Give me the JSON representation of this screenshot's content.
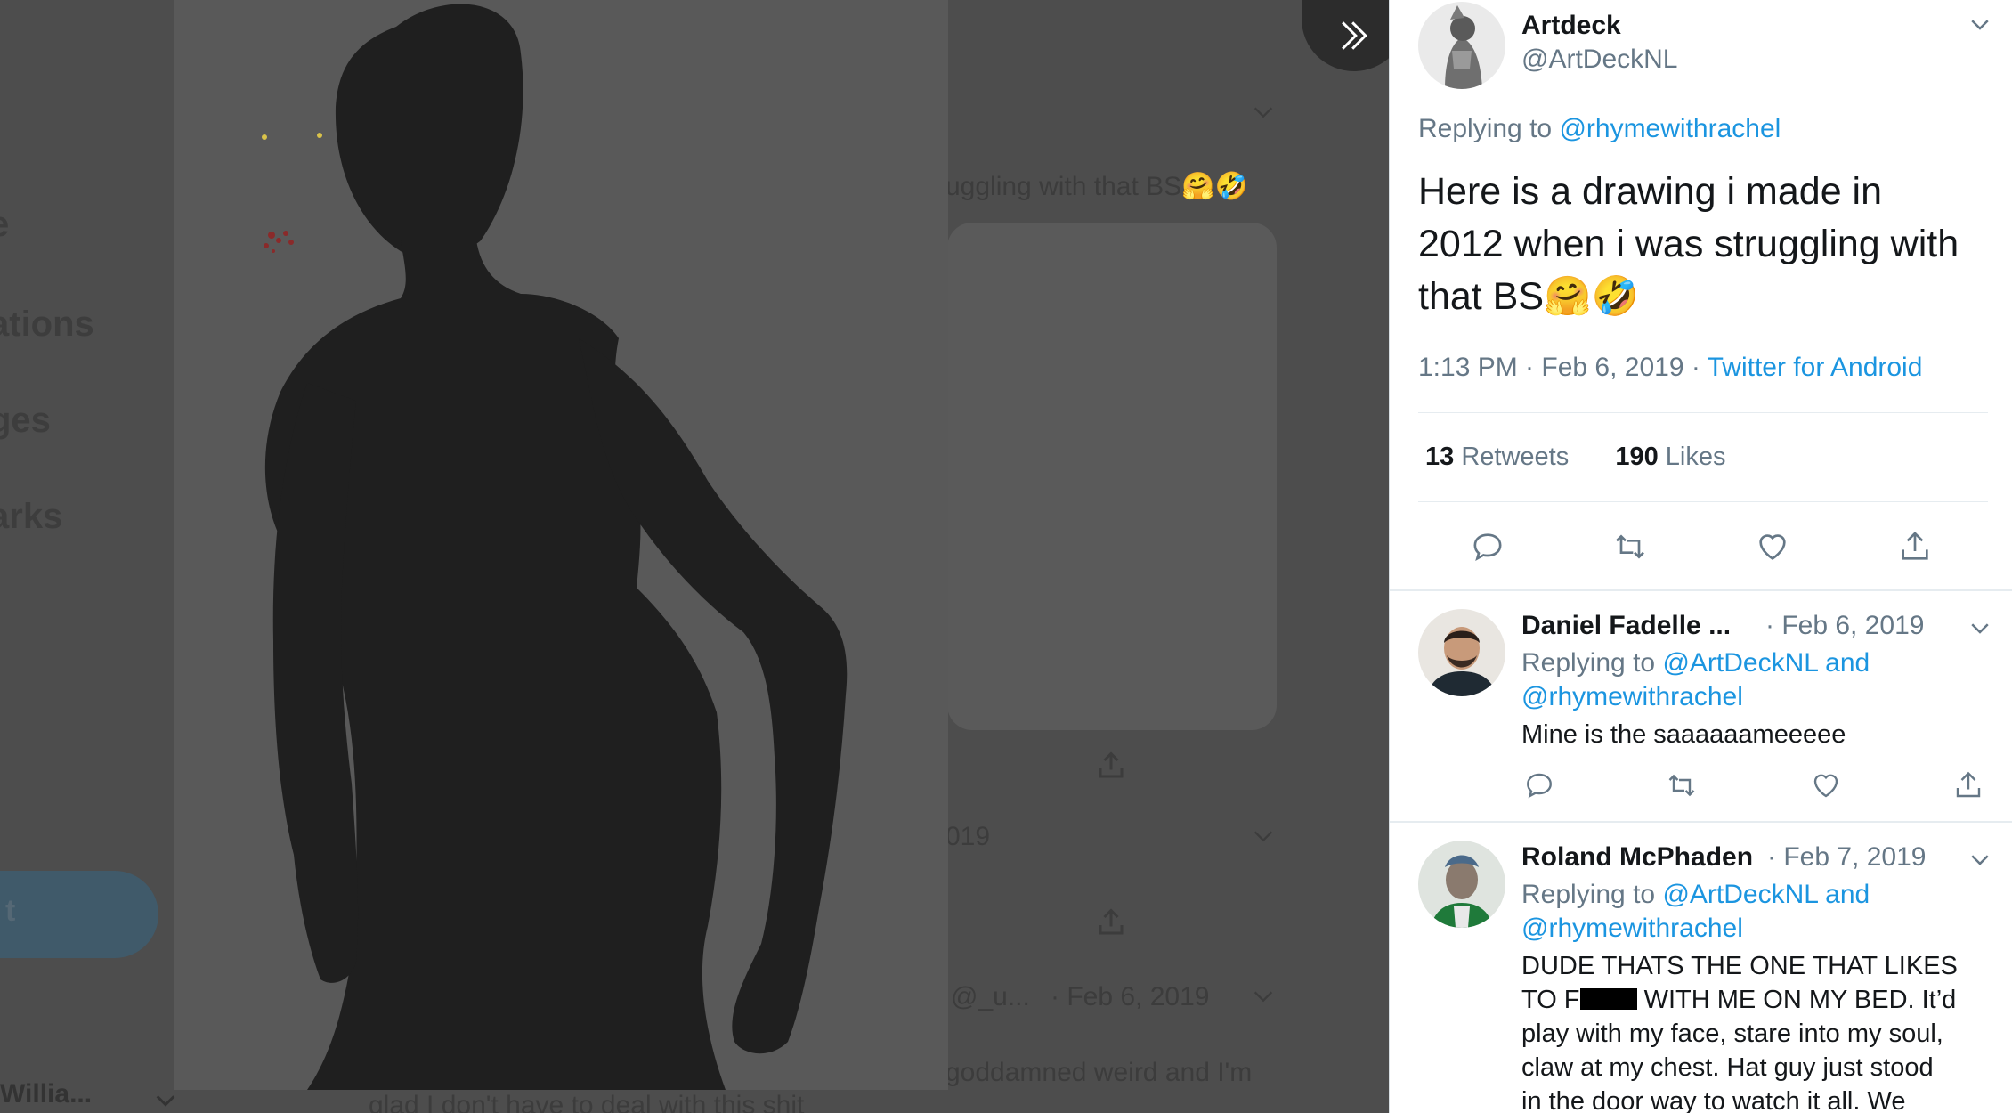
{
  "background": {
    "sidebar_fragments": [
      "e",
      "ations",
      "ges",
      "arks"
    ],
    "tweet_button_fragment": "t",
    "account_fragment": "Willia...",
    "text_fragments": [
      "uggling with that BS🤗🤣",
      "019",
      "@_u...",
      "· Feb 6, 2019",
      "goddamned weird and I'm",
      "glad I don't have to deal with this shit"
    ]
  },
  "media": {
    "expand_icon": "double-chevron-right-icon"
  },
  "tweet": {
    "author_name": "Artdeck",
    "author_handle": "@ArtDeckNL",
    "replying_label": "Replying to",
    "replying_to": "@rhymewithrachel",
    "text_line1": "Here is a drawing i made in",
    "text_line2": "2012 when i was struggling with",
    "text_line3": "that BS",
    "emoji": "🤗🤣",
    "time": "1:13 PM · Feb 6, 2019 · ",
    "source": "Twitter for Android",
    "retweets_count": "13",
    "retweets_label": "Retweets",
    "likes_count": "190",
    "likes_label": "Likes"
  },
  "replies": [
    {
      "name": "Daniel Fadelle ...",
      "date": "· Feb 6, 2019",
      "replying_label": "Replying to",
      "replying_to_1": "@ArtDeckNL and",
      "replying_to_2": "@rhymewithrachel",
      "text": "Mine is the saaaaaameeeee"
    },
    {
      "name": "Roland McPhaden",
      "date": "· Feb 7, 2019",
      "replying_label": "Replying to",
      "replying_to_1": "@ArtDeckNL and",
      "replying_to_2": "@rhymewithrachel",
      "text_line1": "DUDE THATS THE ONE THAT LIKES",
      "text_line2a": "TO F",
      "text_line2b": " WITH ME ON MY BED. It’d",
      "text_line3": "play with my face, stare into my soul,",
      "text_line4": "claw at my chest. Hat guy just stood",
      "text_line5": "in the door way to watch it all. We"
    }
  ],
  "colors": {
    "link": "#1b95e0",
    "secondary_text": "#657786",
    "primary_text": "#14171a",
    "overlay": "#4d4d4d"
  }
}
